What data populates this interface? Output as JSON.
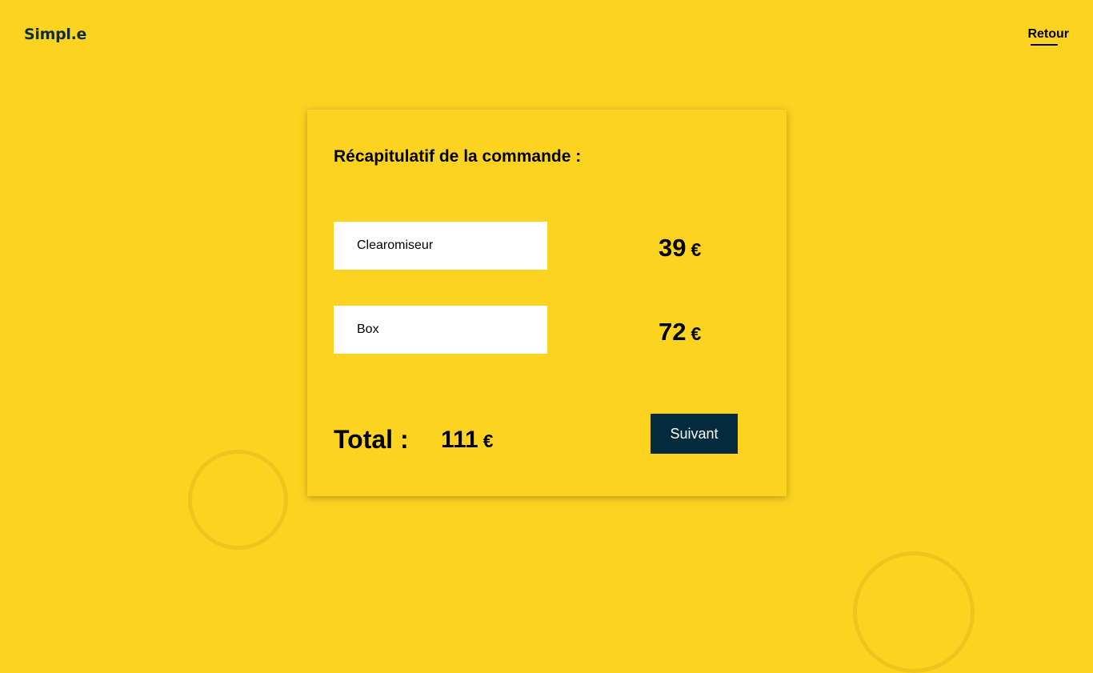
{
  "header": {
    "logo": "Simpl.e",
    "back_label": "Retour"
  },
  "summary": {
    "title": "Récapitulatif de la commande :",
    "items": [
      {
        "name": "Clearomiseur",
        "price": "39",
        "currency": "€"
      },
      {
        "name": "Box",
        "price": "72",
        "currency": "€"
      }
    ],
    "total_label": "Total :",
    "total_value": "111",
    "total_currency": "€",
    "next_label": "Suivant"
  },
  "colors": {
    "background": "#FDD321",
    "button": "#042A3D",
    "logo": "#0c2f3f"
  }
}
